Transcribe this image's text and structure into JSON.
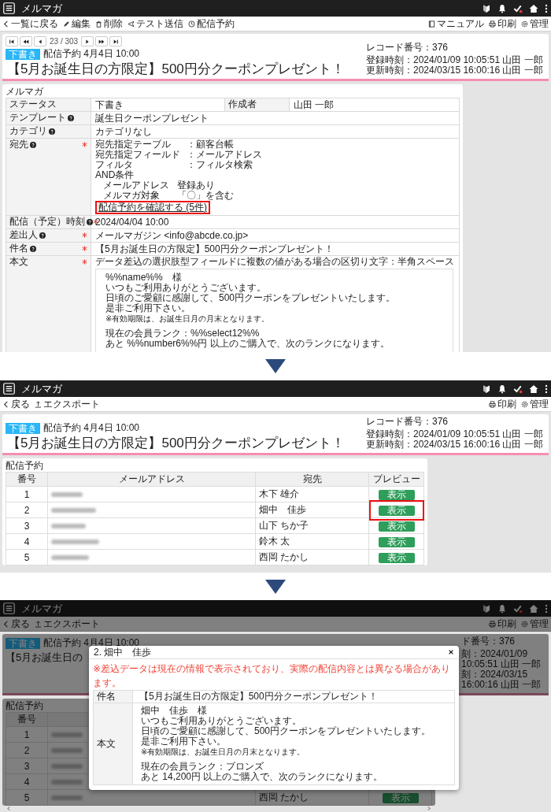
{
  "detail_screen": {
    "header": {
      "title": "メルマガ"
    },
    "toolbar": {
      "left": [
        {
          "kind": "back",
          "label": "一覧に戻る"
        },
        {
          "kind": "edit",
          "label": "編集"
        },
        {
          "kind": "delete",
          "label": "削除"
        },
        {
          "kind": "send",
          "label": "テスト送信"
        },
        {
          "kind": "schedule",
          "label": "配信予約"
        }
      ],
      "right": [
        {
          "kind": "manual",
          "label": "マニュアル"
        },
        {
          "kind": "print",
          "label": "印刷"
        },
        {
          "kind": "settings",
          "label": "管理"
        }
      ]
    },
    "pager": {
      "position": "23 / 303"
    },
    "record": {
      "status": "下書き",
      "schedule": "配信予約 4月4日 10:00",
      "title": "【5月お誕生日の方限定】500円分クーポンプレゼント！",
      "record_no": "レコード番号：376",
      "created": "登録時刻：2024/01/09 10:05:51 山田 一郎",
      "updated": "更新時刻：2024/03/15 16:00:16 山田 一郎"
    },
    "form": {
      "title": "メルマガ",
      "rows": [
        {
          "kind": "pair",
          "label": "ステータス",
          "help": false,
          "required": false,
          "value": "下書き",
          "label_2": "作成者",
          "value_2": "山田 一郎"
        },
        {
          "kind": "text",
          "label": "テンプレート",
          "help": true,
          "required": false,
          "value": "誕生日クーポンプレゼント"
        },
        {
          "kind": "text",
          "label": "カテゴリ",
          "help": true,
          "required": false,
          "value": "カテゴリなし"
        },
        {
          "kind": "recipient",
          "label": "宛先",
          "help": true,
          "required": true,
          "fields": [
            {
              "name": "宛先指定テーブル",
              "value": "：顧客台帳"
            },
            {
              "name": "宛先指定フィールド",
              "value": "：メールアドレス"
            },
            {
              "name": "フィルタ",
              "value": "：フィルタ検索"
            }
          ],
          "condition": "AND条件",
          "conditions": [
            {
              "name": "メールアドレス",
              "value": "登録あり"
            },
            {
              "name": "メルマガ対象",
              "value": "「〇」を含む"
            }
          ],
          "link": {
            "label": "配信予約を確認する (5件)",
            "highlighted": true
          }
        },
        {
          "kind": "text",
          "label": "配信（予定）時刻",
          "help": true,
          "required": true,
          "value": "2024/04/04 10:00"
        },
        {
          "kind": "text",
          "label": "差出人",
          "help": true,
          "required": true,
          "value": "メールマガジン <info@abcde.co.jp>"
        },
        {
          "kind": "text",
          "label": "件名",
          "help": true,
          "required": true,
          "value": "【5月お誕生日の方限定】500円分クーポンプレゼント！"
        },
        {
          "kind": "body",
          "label": "本文",
          "help": false,
          "required": true,
          "note": "データ差込の選択肢型フィールドに複数の値がある場合の区切り文字：半角スペース",
          "lines": [
            {
              "text": "%%name%%　様",
              "small": false,
              "spaced": false
            },
            {
              "text": "いつもご利用ありがとうございます。",
              "small": false,
              "spaced": false
            },
            {
              "text": "日頃のご愛顧に感謝して、500円クーポンをプレゼントいたします。",
              "small": false,
              "spaced": false
            },
            {
              "text": "是非ご利用下さい。",
              "small": false,
              "spaced": false
            },
            {
              "text": "※有効期限は、お誕生日月の月末となります。",
              "small": true,
              "spaced": false
            },
            {
              "text": "現在の会員ランク：%%select12%%",
              "small": false,
              "spaced": true
            },
            {
              "text": "あと %%number6%%円 以上のご購入で、次のランクになります。",
              "small": false,
              "spaced": false
            }
          ]
        }
      ]
    }
  },
  "reservation_screen": {
    "header": {
      "title": "メルマガ"
    },
    "toolbar": {
      "left": [
        {
          "kind": "back",
          "label": "戻る"
        },
        {
          "kind": "export",
          "label": "エクスポート"
        }
      ],
      "right": [
        {
          "kind": "print",
          "label": "印刷"
        },
        {
          "kind": "settings",
          "label": "管理"
        }
      ]
    },
    "record": {
      "status": "下書き",
      "schedule": "配信予約 4月4日 10:00",
      "title": "【5月お誕生日の方限定】500円分クーポンプレゼント！",
      "record_no": "レコード番号：376",
      "created": "登録時刻：2024/01/09 10:05:51 山田 一郎",
      "updated": "更新時刻：2024/03/15 16:00:16 山田 一郎"
    },
    "reservations": {
      "title": "配信予約",
      "columns": [
        "番号",
        "メールアドレス",
        "宛先",
        "プレビュー"
      ],
      "rows": [
        {
          "no": "1",
          "recipient": "木下 雄介",
          "button": "表示",
          "highlighted": false
        },
        {
          "no": "2",
          "recipient": "畑中　佳歩",
          "button": "表示",
          "highlighted": true
        },
        {
          "no": "3",
          "recipient": "山下 ちか子",
          "button": "表示",
          "highlighted": false
        },
        {
          "no": "4",
          "recipient": "鈴木 太",
          "button": "表示",
          "highlighted": false
        },
        {
          "no": "5",
          "recipient": "西岡 たかし",
          "button": "表示",
          "highlighted": false
        }
      ]
    }
  },
  "preview_screen": {
    "header": {
      "title": "メルマガ"
    },
    "toolbar": {
      "left": [
        {
          "kind": "back",
          "label": "戻る"
        },
        {
          "kind": "export",
          "label": "エクスポート"
        }
      ],
      "right": [
        {
          "kind": "print",
          "label": "印刷"
        },
        {
          "kind": "settings",
          "label": "管理"
        }
      ]
    },
    "record": {
      "status": "下書き",
      "schedule": "配信予約 4月4日 10:00",
      "title": "【5月お誕生日の",
      "record_no": "ド番号：376",
      "created": "刻：2024/01/09 10:05:51 山田 一郎",
      "updated": "刻：2024/03/15 16:00:16 山田 一郎"
    },
    "reservations": {
      "title": "配信予約",
      "columns": [
        "番号"
      ],
      "rows": [
        {
          "no": "1"
        },
        {
          "no": "2"
        },
        {
          "no": "3"
        },
        {
          "no": "4"
        },
        {
          "no": "5",
          "recipient": "西岡 たかし",
          "button": "表示",
          "highlighted": false
        }
      ]
    },
    "modal": {
      "title": "2. 畑中　佳歩",
      "notice": "※差込データは現在の情報で表示されており、実際の配信内容とは異なる場合があります。",
      "subject_label": "件名",
      "subject": "【5月お誕生日の方限定】500円分クーポンプレゼント！",
      "body_label": "本文",
      "lines": [
        {
          "text": "畑中　佳歩　様",
          "small": false,
          "spaced": false
        },
        {
          "text": "いつもご利用ありがとうございます。",
          "small": false,
          "spaced": false
        },
        {
          "text": "日頃のご愛顧に感謝して、500円クーポンをプレゼントいたします。",
          "small": false,
          "spaced": false
        },
        {
          "text": "是非ご利用下さい。",
          "small": false,
          "spaced": false
        },
        {
          "text": "※有効期限は、お誕生日月の月末となります。",
          "small": true,
          "spaced": false
        },
        {
          "text": "現在の会員ランク：ブロンズ",
          "small": false,
          "spaced": true
        },
        {
          "text": "あと 14,200円 以上のご購入で、次のランクになります。",
          "small": false,
          "spaced": false
        }
      ]
    }
  }
}
